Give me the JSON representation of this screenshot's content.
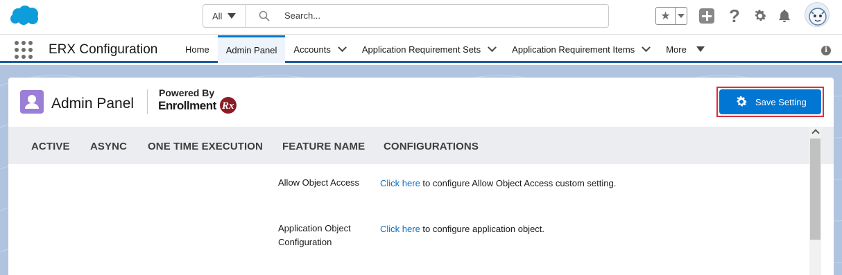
{
  "header": {
    "search_scope": "All",
    "search_placeholder": "Search...",
    "help_glyph": "?"
  },
  "nav": {
    "app_name": "ERX Configuration",
    "items": [
      {
        "label": "Home",
        "active": false,
        "dropdown": false
      },
      {
        "label": "Admin Panel",
        "active": true,
        "dropdown": false
      },
      {
        "label": "Accounts",
        "active": false,
        "dropdown": true
      },
      {
        "label": "Application Requirement Sets",
        "active": false,
        "dropdown": true
      },
      {
        "label": "Application Requirement Items",
        "active": false,
        "dropdown": true
      },
      {
        "label": "More",
        "active": false,
        "dropdown": true
      }
    ],
    "info_glyph": "i"
  },
  "card": {
    "title": "Admin Panel",
    "powered_by": "Powered By",
    "brand": "Enrollment",
    "brand_mark": "Rx",
    "save_button": "Save Setting"
  },
  "table": {
    "headers": [
      "ACTIVE",
      "ASYNC",
      "ONE TIME EXECUTION",
      "FEATURE NAME",
      "CONFIGURATIONS"
    ],
    "rows": [
      {
        "feature": "Allow Object Access",
        "link": "Click here",
        "text": " to configure Allow Object Access custom setting."
      },
      {
        "feature": "Application Object Configuration",
        "link": "Click here",
        "text": " to configure application object."
      }
    ]
  },
  "colors": {
    "brand_blue": "#0176d3",
    "highlight_red": "#d9303a",
    "object_icon": "#9b7ed6"
  }
}
